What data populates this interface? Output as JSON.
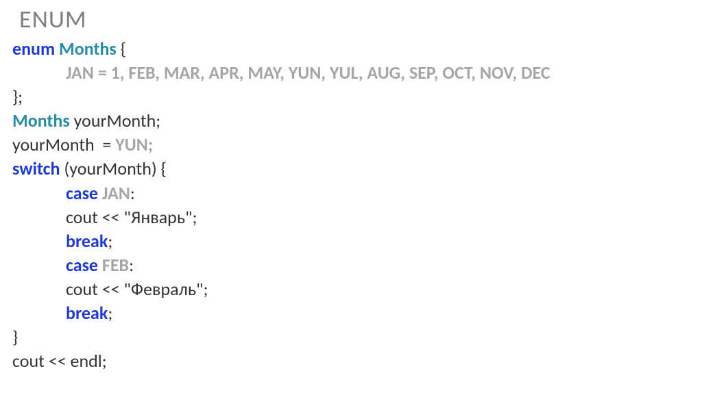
{
  "title": "ENUM",
  "code": {
    "l1_enum": "enum",
    "l1_months": "Months",
    "l1_brace": " {",
    "l2_values": "JAN = 1, FEB, MAR, APR, MAY, YUN, YUL, AUG, SEP, OCT, NOV, DEC",
    "l3": "};",
    "l4_months": "Months",
    "l4_rest": " yourMonth;",
    "l5_a": "yourMonth  = ",
    "l5_yun": "YUN;",
    "l6_switch": "switch",
    "l6_rest": " (yourMonth) {",
    "l7_case": "case",
    "l7_jan": "JAN",
    "l7_colon": ":",
    "l8": "cout << \"Январь\";",
    "l9_break": "break",
    "l9_semi": ";",
    "l10_case": "case",
    "l10_feb": "FEB",
    "l10_colon": ":",
    "l11": "cout << \"Февраль\";",
    "l12_break": "break",
    "l12_semi": ";",
    "l13": "}",
    "l14": "cout << endl;"
  }
}
